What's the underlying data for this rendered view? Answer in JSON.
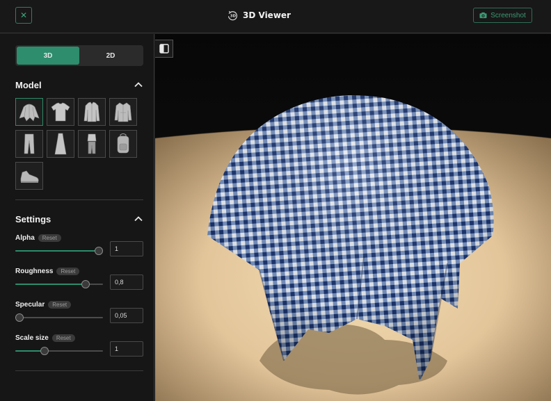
{
  "header": {
    "title": "3D Viewer",
    "icon_text": "3D",
    "screenshot_label": "Screenshot"
  },
  "mode_toggle": {
    "options": [
      "3D",
      "2D"
    ],
    "selected": "3D"
  },
  "model_section": {
    "title": "Model",
    "models": [
      "drape-cloth",
      "tshirt",
      "dress-shirt",
      "jacket",
      "pants",
      "dress",
      "outfit",
      "backpack",
      "sneaker"
    ],
    "selected": "drape-cloth"
  },
  "settings_section": {
    "title": "Settings",
    "reset_label": "Reset",
    "items": [
      {
        "label": "Alpha",
        "value": "1",
        "fraction": 1.0
      },
      {
        "label": "Roughness",
        "value": "0,8",
        "fraction": 0.8
      },
      {
        "label": "Specular",
        "value": "0,05",
        "fraction": 0.05
      },
      {
        "label": "Scale size",
        "value": "1",
        "fraction": 0.33
      }
    ]
  },
  "colors": {
    "accent": "#2d8d6c",
    "background": "#161616",
    "cloth_blue": "#1f3f7a"
  }
}
